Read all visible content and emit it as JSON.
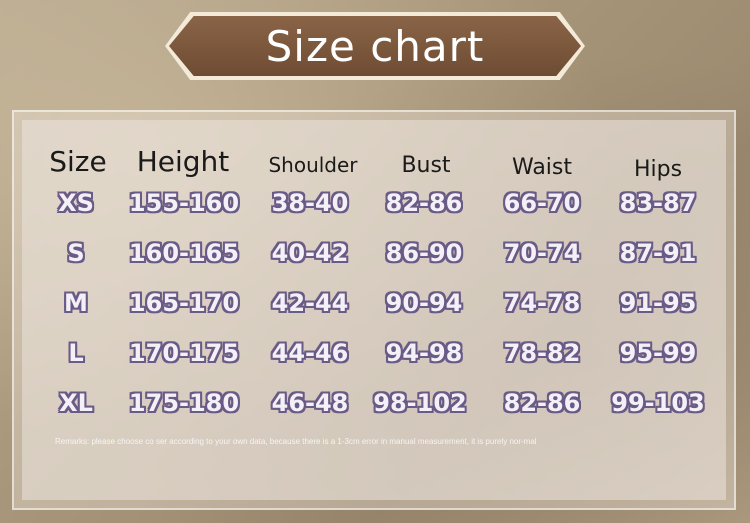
{
  "title": "Size chart",
  "headers": [
    "Size",
    "Height",
    "Shoulder",
    "Bust",
    "Waist",
    "Hips"
  ],
  "rows": [
    [
      "XS",
      "155-160",
      "38-40",
      "82-86",
      "66-70",
      "83-87"
    ],
    [
      "S",
      "160-165",
      "40-42",
      "86-90",
      "70-74",
      "87-91"
    ],
    [
      "M",
      "165-170",
      "42-44",
      "90-94",
      "74-78",
      "91-95"
    ],
    [
      "L",
      "170-175",
      "44-46",
      "94-98",
      "78-82",
      "95-99"
    ],
    [
      "XL",
      "175-180",
      "46-48",
      "98-102",
      "82-86",
      "99-103"
    ]
  ],
  "remarks": "Remarks: please choose co ser according to your own data, because there is a 1-3cm error in manual measurement, it is purely nor-mal",
  "colors": {
    "banner": "#6e4c33",
    "cell_text": "#f3f0f7",
    "cell_outline": "#6a5a86",
    "header_text": "#1a1a1a"
  }
}
